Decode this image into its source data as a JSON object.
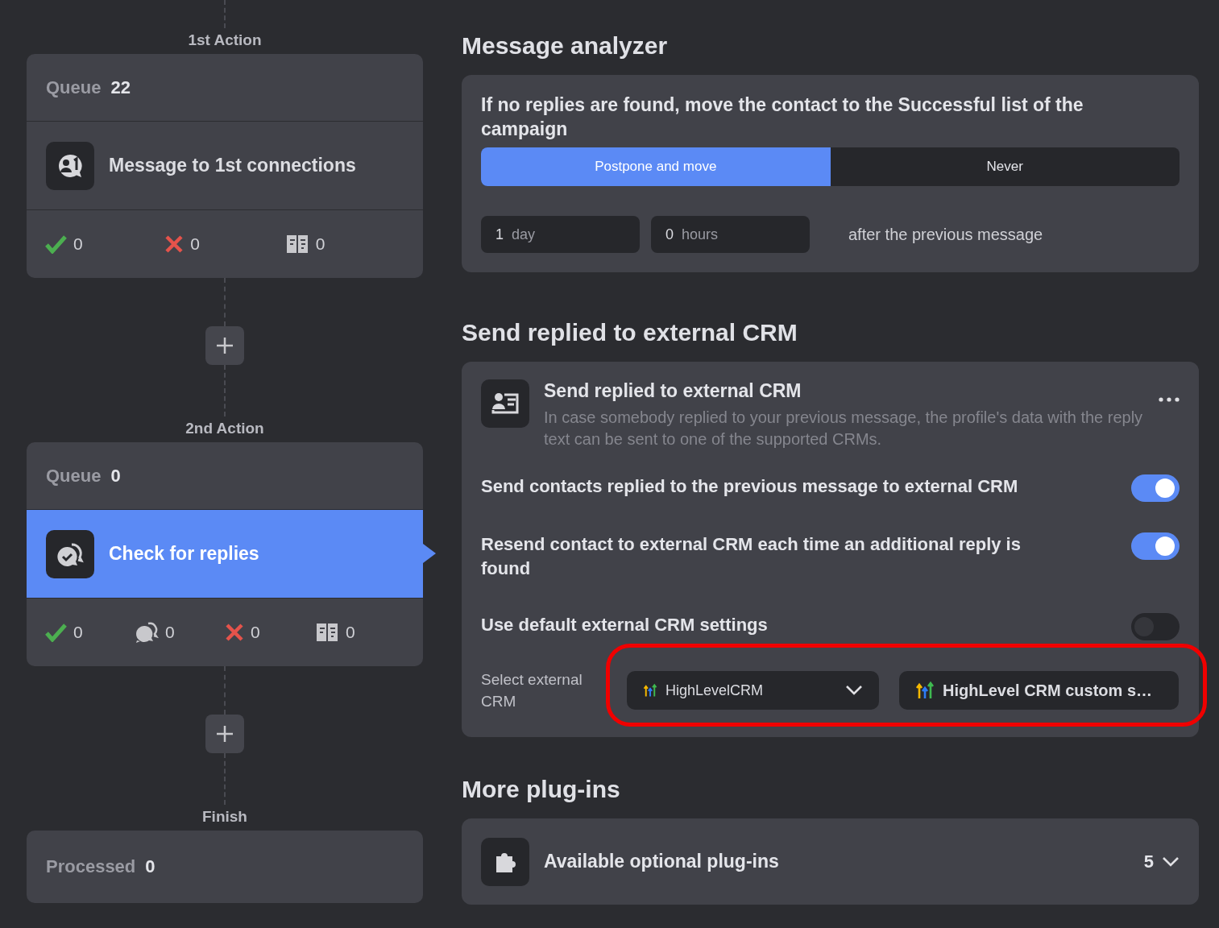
{
  "flow": {
    "steps": [
      {
        "kind": "message",
        "label": "1st Action",
        "queue_label": "Queue",
        "queue_count": "22",
        "title": "Message to 1st connections",
        "selected": false,
        "stats": [
          {
            "kind": "success",
            "value": "0"
          },
          {
            "kind": "failed",
            "value": "0"
          },
          {
            "kind": "skipped",
            "value": "0"
          }
        ]
      },
      {
        "kind": "check",
        "label": "2nd Action",
        "queue_label": "Queue",
        "queue_count": "0",
        "title": "Check for replies",
        "selected": true,
        "stats": [
          {
            "kind": "success",
            "value": "0"
          },
          {
            "kind": "replied",
            "value": "0"
          },
          {
            "kind": "failed",
            "value": "0"
          },
          {
            "kind": "skipped",
            "value": "0"
          }
        ]
      },
      {
        "kind": "finish",
        "label": "Finish",
        "queue_label": "Processed",
        "queue_count": "0"
      }
    ]
  },
  "analyzer": {
    "heading": "Message analyzer",
    "question": "If no replies are found, move the contact to the Successful list of the campaign",
    "options": [
      {
        "label": "Postpone and move",
        "selected": true
      },
      {
        "label": "Never",
        "selected": false
      }
    ],
    "delay": [
      {
        "value": "1",
        "unit": "day"
      },
      {
        "value": "0",
        "unit": "hours"
      }
    ],
    "delay_suffix": "after the previous message"
  },
  "crm": {
    "heading": "Send replied to external CRM",
    "card_title": "Send replied to external CRM",
    "description": "In case somebody replied to your previous message, the profile's data with the reply text can be sent to one of the supported CRMs.",
    "settings": [
      {
        "label": "Send contacts replied to the previous message to external CRM",
        "on": true
      },
      {
        "label": "Resend contact to external CRM each time an additional reply is found",
        "on": true
      },
      {
        "label": "Use default external CRM settings",
        "on": false
      }
    ],
    "select_label": "Select external CRM",
    "highlighted": true,
    "selects": [
      {
        "kind": "dropdown",
        "value": "HighLevelCRM"
      },
      {
        "kind": "field",
        "value": "HighLevel CRM custom s…"
      }
    ]
  },
  "plugins": {
    "heading": "More plug-ins",
    "title": "Available optional plug-ins",
    "count": "5",
    "expanded": false
  }
}
